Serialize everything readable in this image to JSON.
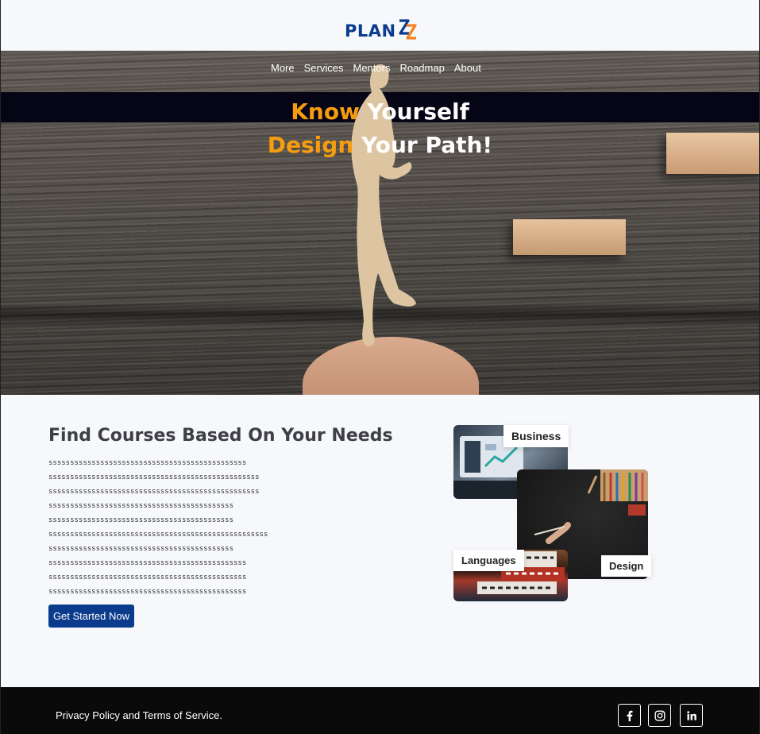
{
  "header": {
    "logo_text": "PLAN"
  },
  "nav": {
    "items": [
      "More",
      "Services",
      "Mentors",
      "Roadmap",
      "About"
    ]
  },
  "hero": {
    "line1_accent": "Know",
    "line1_rest": " Yourself",
    "line2_accent": "Design",
    "line2_rest": " Your Path!"
  },
  "main": {
    "heading": "Find Courses Based On Your Needs",
    "body_lines": [
      "ssssssssssssssssssssssssssssssssssssssssssssss",
      "sssssssssssssssssssssssssssssssssssssssssssssssss",
      "sssssssssssssssssssssssssssssssssssssssssssssssss",
      "sssssssssssssssssssssssssssssssssssssssssss",
      "sssssssssssssssssssssssssssssssssssssssssss",
      "sssssssssssssssssssssssssssssssssssssssssssssssssss",
      "sssssssssssssssssssssssssssssssssssssssssss",
      "ssssssssssssssssssssssssssssssssssssssssssssss",
      "ssssssssssssssssssssssssssssssssssssssssssssss",
      "ssssssssssssssssssssssssssssssssssssssssssssss"
    ],
    "cta_label": "Get Started Now"
  },
  "collage": {
    "business": "Business",
    "languages": "Languages",
    "design": "Design"
  },
  "footer": {
    "text": "Privacy Policy and Terms of Service."
  },
  "social": [
    {
      "name": "facebook-icon"
    },
    {
      "name": "instagram-icon"
    },
    {
      "name": "linkedin-icon"
    }
  ],
  "colors": {
    "accent": "#f59d0f",
    "brand": "#0b3b8c",
    "footer_bg": "#0a0a0a"
  }
}
